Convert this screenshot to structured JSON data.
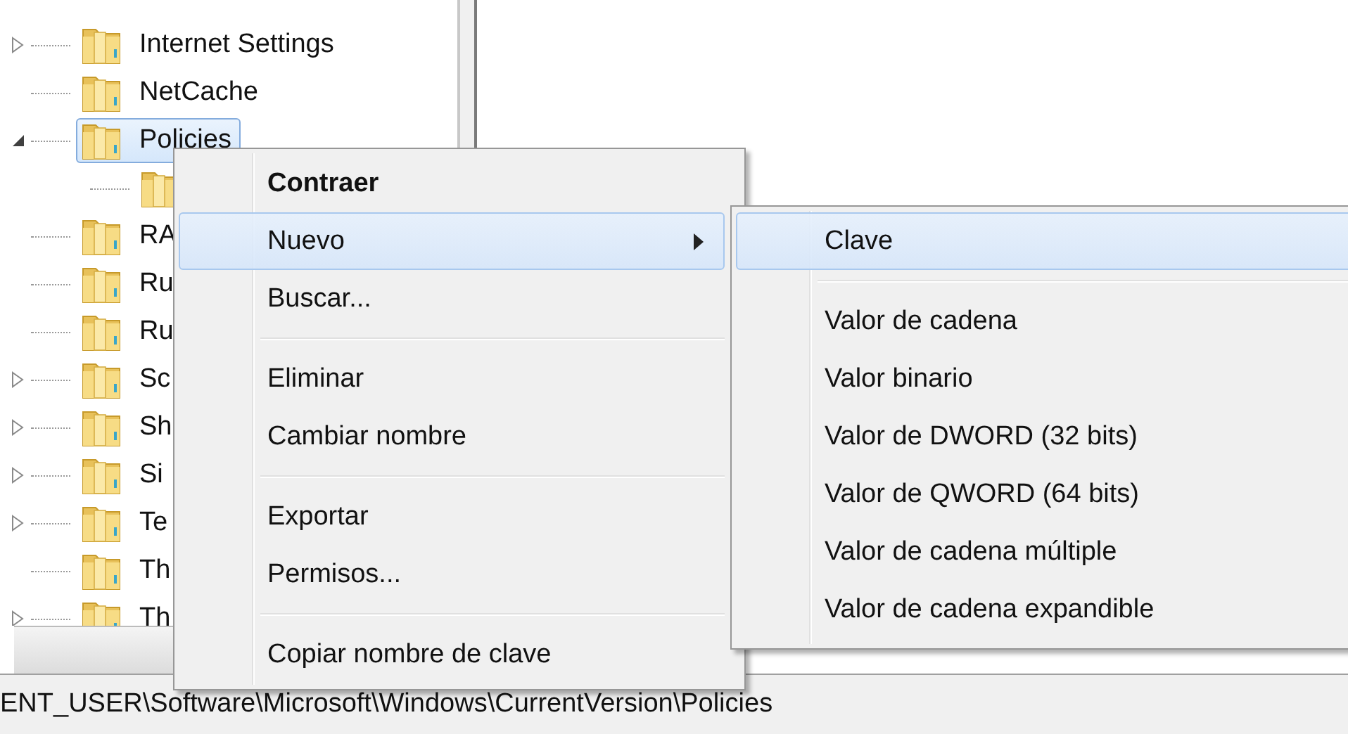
{
  "tree": {
    "items": [
      {
        "label": "Internet Settings",
        "has_children": true,
        "expanded": false,
        "selected": false
      },
      {
        "label": "NetCache",
        "has_children": false,
        "selected": false
      },
      {
        "label": "Policies",
        "has_children": true,
        "expanded": true,
        "selected": true,
        "children": [
          {
            "has_children": false,
            "selected": false
          }
        ]
      },
      {
        "label": "RA",
        "has_children": false,
        "selected": false
      },
      {
        "label": "Ru",
        "has_children": false,
        "selected": false
      },
      {
        "label": "Ru",
        "has_children": false,
        "selected": false
      },
      {
        "label": "Sc",
        "has_children": true,
        "expanded": false,
        "selected": false
      },
      {
        "label": "Sh",
        "has_children": true,
        "expanded": false,
        "selected": false
      },
      {
        "label": "Si",
        "has_children": true,
        "expanded": false,
        "selected": false
      },
      {
        "label": "Te",
        "has_children": true,
        "expanded": false,
        "selected": false
      },
      {
        "label": "Th",
        "has_children": false,
        "selected": false
      },
      {
        "label": "Th",
        "has_children": true,
        "expanded": false,
        "selected": false
      }
    ]
  },
  "status_bar": {
    "path": "ENT_USER\\Software\\Microsoft\\Windows\\CurrentVersion\\Policies"
  },
  "context_menu": {
    "items": [
      {
        "kind": "item",
        "label": "Contraer",
        "default": true,
        "selected": false,
        "has_submenu": false
      },
      {
        "kind": "item",
        "label": "Nuevo",
        "default": false,
        "selected": true,
        "has_submenu": true
      },
      {
        "kind": "item",
        "label": "Buscar...",
        "default": false,
        "selected": false,
        "has_submenu": false
      },
      {
        "kind": "separator"
      },
      {
        "kind": "item",
        "label": "Eliminar",
        "default": false,
        "selected": false,
        "has_submenu": false
      },
      {
        "kind": "item",
        "label": "Cambiar nombre",
        "default": false,
        "selected": false,
        "has_submenu": false
      },
      {
        "kind": "separator"
      },
      {
        "kind": "item",
        "label": "Exportar",
        "default": false,
        "selected": false,
        "has_submenu": false
      },
      {
        "kind": "item",
        "label": "Permisos...",
        "default": false,
        "selected": false,
        "has_submenu": false
      },
      {
        "kind": "separator"
      },
      {
        "kind": "item",
        "label": "Copiar nombre de clave",
        "default": false,
        "selected": false,
        "has_submenu": false
      }
    ]
  },
  "submenu": {
    "items": [
      {
        "kind": "item",
        "label": "Clave",
        "selected": true
      },
      {
        "kind": "separator"
      },
      {
        "kind": "item",
        "label": "Valor de cadena",
        "selected": false
      },
      {
        "kind": "item",
        "label": "Valor binario",
        "selected": false
      },
      {
        "kind": "item",
        "label": "Valor de DWORD (32 bits)",
        "selected": false
      },
      {
        "kind": "item",
        "label": "Valor de QWORD (64 bits)",
        "selected": false
      },
      {
        "kind": "item",
        "label": "Valor de cadena múltiple",
        "selected": false
      },
      {
        "kind": "item",
        "label": "Valor de cadena expandible",
        "selected": false
      }
    ]
  }
}
